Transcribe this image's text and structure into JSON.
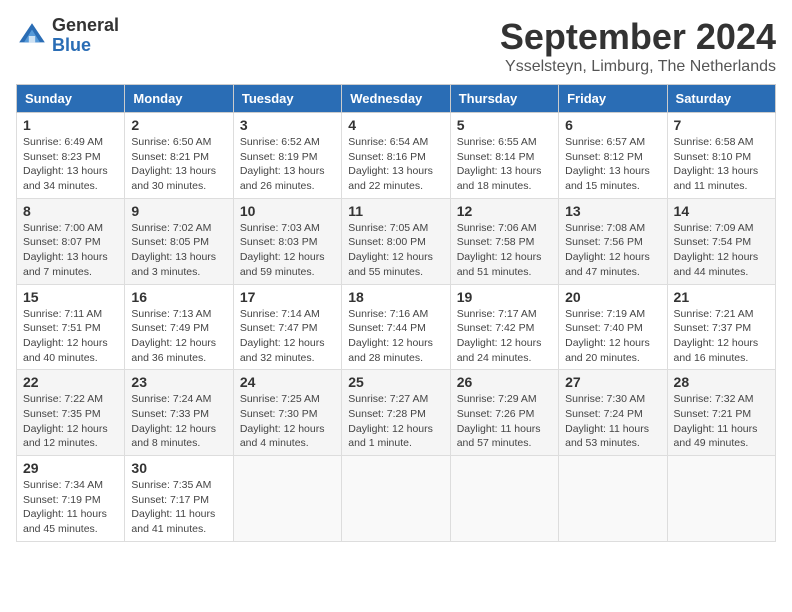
{
  "header": {
    "logo_general": "General",
    "logo_blue": "Blue",
    "month_title": "September 2024",
    "location": "Ysselsteyn, Limburg, The Netherlands"
  },
  "weekdays": [
    "Sunday",
    "Monday",
    "Tuesday",
    "Wednesday",
    "Thursday",
    "Friday",
    "Saturday"
  ],
  "weeks": [
    [
      {
        "day": 1,
        "info": "Sunrise: 6:49 AM\nSunset: 8:23 PM\nDaylight: 13 hours\nand 34 minutes."
      },
      {
        "day": 2,
        "info": "Sunrise: 6:50 AM\nSunset: 8:21 PM\nDaylight: 13 hours\nand 30 minutes."
      },
      {
        "day": 3,
        "info": "Sunrise: 6:52 AM\nSunset: 8:19 PM\nDaylight: 13 hours\nand 26 minutes."
      },
      {
        "day": 4,
        "info": "Sunrise: 6:54 AM\nSunset: 8:16 PM\nDaylight: 13 hours\nand 22 minutes."
      },
      {
        "day": 5,
        "info": "Sunrise: 6:55 AM\nSunset: 8:14 PM\nDaylight: 13 hours\nand 18 minutes."
      },
      {
        "day": 6,
        "info": "Sunrise: 6:57 AM\nSunset: 8:12 PM\nDaylight: 13 hours\nand 15 minutes."
      },
      {
        "day": 7,
        "info": "Sunrise: 6:58 AM\nSunset: 8:10 PM\nDaylight: 13 hours\nand 11 minutes."
      }
    ],
    [
      {
        "day": 8,
        "info": "Sunrise: 7:00 AM\nSunset: 8:07 PM\nDaylight: 13 hours\nand 7 minutes."
      },
      {
        "day": 9,
        "info": "Sunrise: 7:02 AM\nSunset: 8:05 PM\nDaylight: 13 hours\nand 3 minutes."
      },
      {
        "day": 10,
        "info": "Sunrise: 7:03 AM\nSunset: 8:03 PM\nDaylight: 12 hours\nand 59 minutes."
      },
      {
        "day": 11,
        "info": "Sunrise: 7:05 AM\nSunset: 8:00 PM\nDaylight: 12 hours\nand 55 minutes."
      },
      {
        "day": 12,
        "info": "Sunrise: 7:06 AM\nSunset: 7:58 PM\nDaylight: 12 hours\nand 51 minutes."
      },
      {
        "day": 13,
        "info": "Sunrise: 7:08 AM\nSunset: 7:56 PM\nDaylight: 12 hours\nand 47 minutes."
      },
      {
        "day": 14,
        "info": "Sunrise: 7:09 AM\nSunset: 7:54 PM\nDaylight: 12 hours\nand 44 minutes."
      }
    ],
    [
      {
        "day": 15,
        "info": "Sunrise: 7:11 AM\nSunset: 7:51 PM\nDaylight: 12 hours\nand 40 minutes."
      },
      {
        "day": 16,
        "info": "Sunrise: 7:13 AM\nSunset: 7:49 PM\nDaylight: 12 hours\nand 36 minutes."
      },
      {
        "day": 17,
        "info": "Sunrise: 7:14 AM\nSunset: 7:47 PM\nDaylight: 12 hours\nand 32 minutes."
      },
      {
        "day": 18,
        "info": "Sunrise: 7:16 AM\nSunset: 7:44 PM\nDaylight: 12 hours\nand 28 minutes."
      },
      {
        "day": 19,
        "info": "Sunrise: 7:17 AM\nSunset: 7:42 PM\nDaylight: 12 hours\nand 24 minutes."
      },
      {
        "day": 20,
        "info": "Sunrise: 7:19 AM\nSunset: 7:40 PM\nDaylight: 12 hours\nand 20 minutes."
      },
      {
        "day": 21,
        "info": "Sunrise: 7:21 AM\nSunset: 7:37 PM\nDaylight: 12 hours\nand 16 minutes."
      }
    ],
    [
      {
        "day": 22,
        "info": "Sunrise: 7:22 AM\nSunset: 7:35 PM\nDaylight: 12 hours\nand 12 minutes."
      },
      {
        "day": 23,
        "info": "Sunrise: 7:24 AM\nSunset: 7:33 PM\nDaylight: 12 hours\nand 8 minutes."
      },
      {
        "day": 24,
        "info": "Sunrise: 7:25 AM\nSunset: 7:30 PM\nDaylight: 12 hours\nand 4 minutes."
      },
      {
        "day": 25,
        "info": "Sunrise: 7:27 AM\nSunset: 7:28 PM\nDaylight: 12 hours\nand 1 minute."
      },
      {
        "day": 26,
        "info": "Sunrise: 7:29 AM\nSunset: 7:26 PM\nDaylight: 11 hours\nand 57 minutes."
      },
      {
        "day": 27,
        "info": "Sunrise: 7:30 AM\nSunset: 7:24 PM\nDaylight: 11 hours\nand 53 minutes."
      },
      {
        "day": 28,
        "info": "Sunrise: 7:32 AM\nSunset: 7:21 PM\nDaylight: 11 hours\nand 49 minutes."
      }
    ],
    [
      {
        "day": 29,
        "info": "Sunrise: 7:34 AM\nSunset: 7:19 PM\nDaylight: 11 hours\nand 45 minutes."
      },
      {
        "day": 30,
        "info": "Sunrise: 7:35 AM\nSunset: 7:17 PM\nDaylight: 11 hours\nand 41 minutes."
      },
      null,
      null,
      null,
      null,
      null
    ]
  ]
}
